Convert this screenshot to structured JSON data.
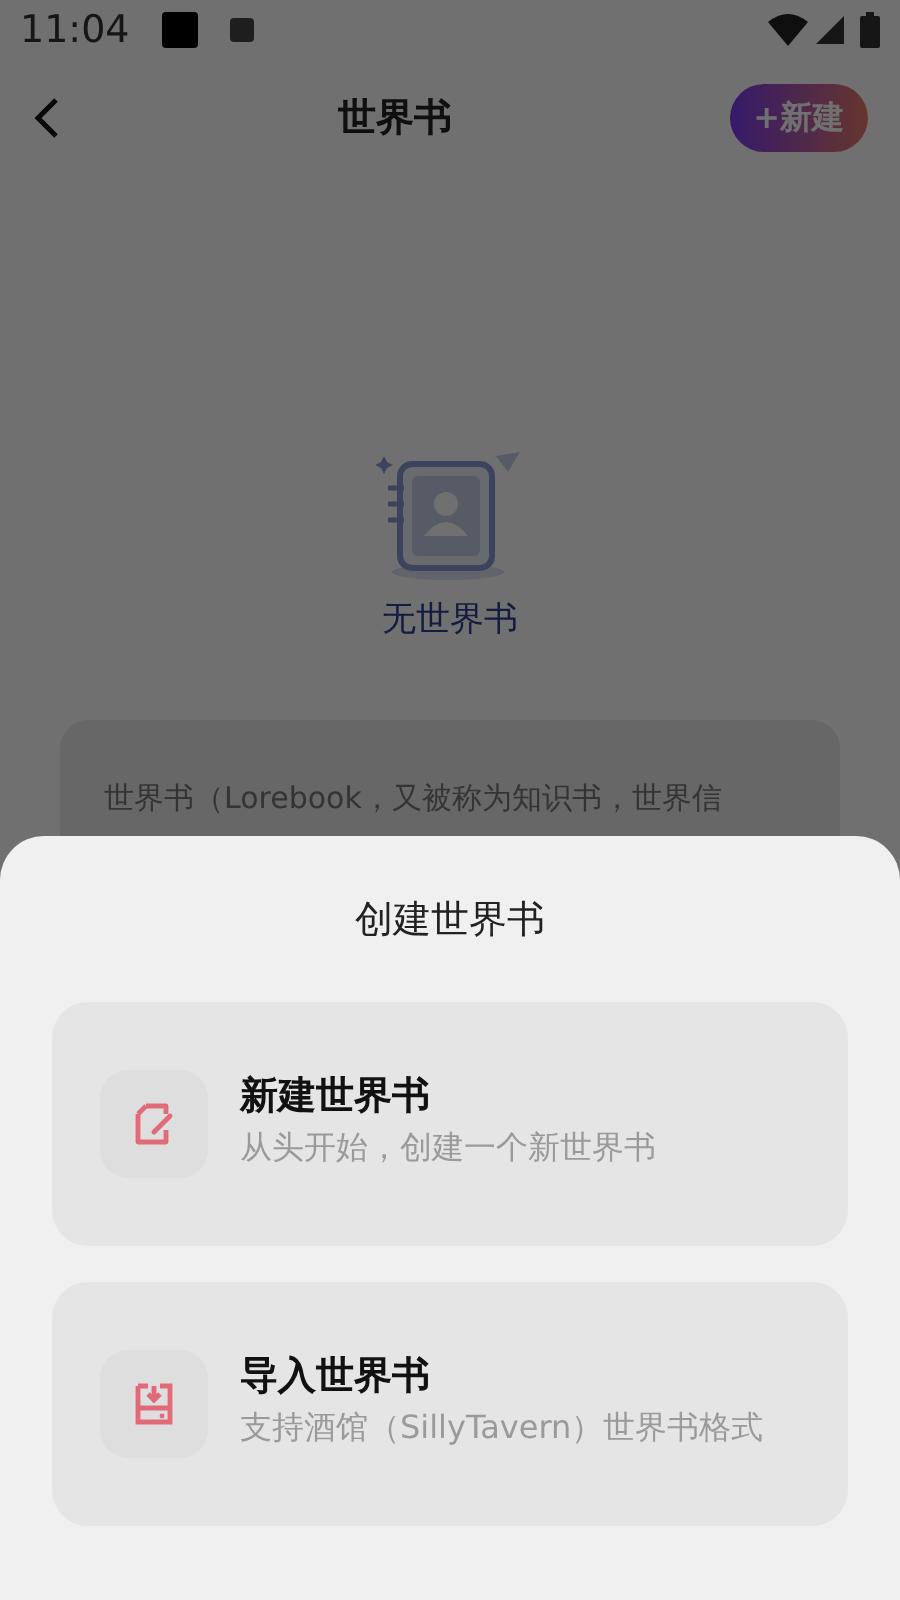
{
  "status_bar": {
    "time": "11:04"
  },
  "header": {
    "title": "世界书",
    "new_button": "+新建"
  },
  "empty_state": {
    "label": "无世界书"
  },
  "info_card": {
    "text": "世界书（Lorebook，又被称为知识书，世界信"
  },
  "sheet": {
    "title": "创建世界书",
    "options": [
      {
        "kind": "new",
        "title": "新建世界书",
        "description": "从头开始，创建一个新世界书"
      },
      {
        "kind": "import",
        "title": "导入世界书",
        "description": "支持酒馆（SillyTavern）世界书格式"
      }
    ]
  }
}
